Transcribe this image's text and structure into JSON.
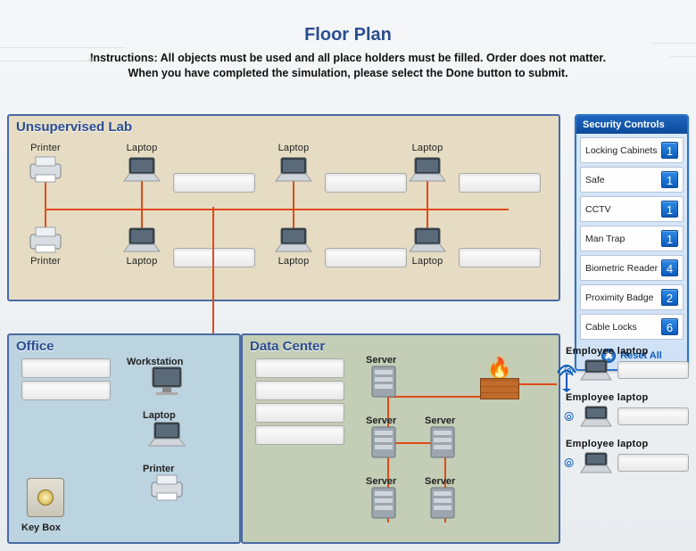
{
  "title": "Floor Plan",
  "instructions_line1": "Instructions: All objects must be used and all place holders must be filled. Order does not matter.",
  "instructions_line2": "When you have completed the simulation, please select the Done button to submit.",
  "zones": {
    "lab": {
      "title": "Unsupervised Lab"
    },
    "office": {
      "title": "Office"
    },
    "datacenter": {
      "title": "Data Center"
    }
  },
  "devices": {
    "printer": "Printer",
    "laptop": "Laptop",
    "workstation": "Workstation",
    "server": "Server",
    "keybox": "Key Box"
  },
  "panel": {
    "header": "Security Controls",
    "reset": "Reset  All",
    "items": [
      {
        "label": "Locking Cabinets",
        "count": "1"
      },
      {
        "label": "Safe",
        "count": "1"
      },
      {
        "label": "CCTV",
        "count": "1"
      },
      {
        "label": "Man Trap",
        "count": "1"
      },
      {
        "label": "Biometric Reader",
        "count": "4"
      },
      {
        "label": "Proximity Badge",
        "count": "2"
      },
      {
        "label": "Cable Locks",
        "count": "6"
      }
    ]
  },
  "employee": {
    "label": "Employee laptop"
  }
}
